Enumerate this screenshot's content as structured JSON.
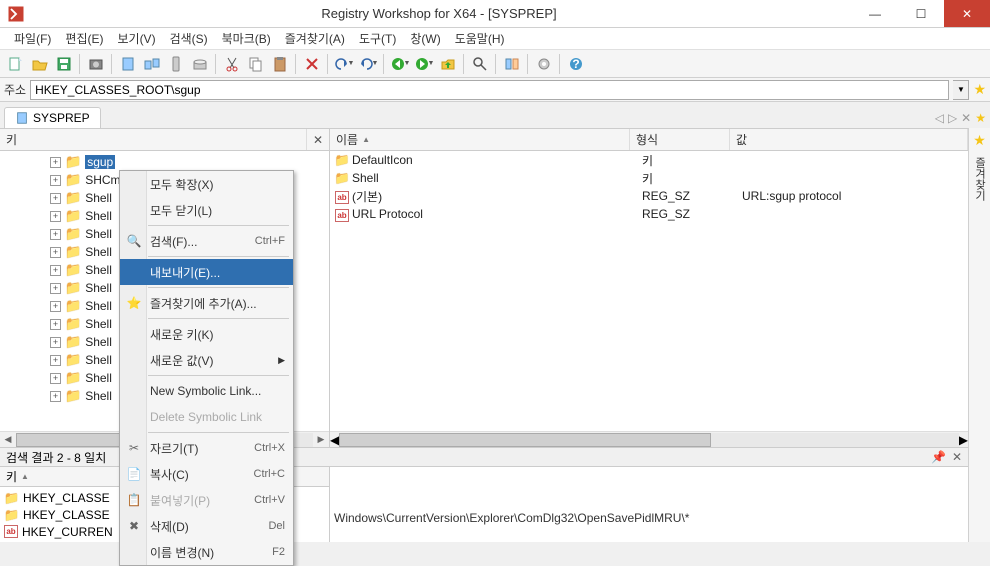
{
  "title": "Registry Workshop for X64 - [SYSPREP]",
  "menu": [
    "파일(F)",
    "편집(E)",
    "보기(V)",
    "검색(S)",
    "북마크(B)",
    "즐겨찾기(A)",
    "도구(T)",
    "창(W)",
    "도움말(H)"
  ],
  "address_label": "주소",
  "address_value": "HKEY_CLASSES_ROOT\\sgup",
  "tab_label": "SYSPREP",
  "rightstrip_label": "즐겨찾기",
  "tree_header": "키",
  "tree_items": [
    {
      "label": "sgup",
      "selected": true
    },
    {
      "label": "SHCm"
    },
    {
      "label": "Shell"
    },
    {
      "label": "Shell"
    },
    {
      "label": "Shell"
    },
    {
      "label": "Shell"
    },
    {
      "label": "Shell"
    },
    {
      "label": "Shell"
    },
    {
      "label": "Shell"
    },
    {
      "label": "Shell"
    },
    {
      "label": "Shell"
    },
    {
      "label": "Shell"
    },
    {
      "label": "Shell"
    },
    {
      "label": "Shell"
    }
  ],
  "list_headers": {
    "name": "이름",
    "type": "형식",
    "value": "값"
  },
  "list_rows": [
    {
      "icon": "folder",
      "name": "DefaultIcon",
      "type": "키",
      "value": ""
    },
    {
      "icon": "folder",
      "name": "Shell",
      "type": "키",
      "value": ""
    },
    {
      "icon": "ab",
      "name": "(기본)",
      "type": "REG_SZ",
      "value": "URL:sgup protocol"
    },
    {
      "icon": "ab",
      "name": "URL Protocol",
      "type": "REG_SZ",
      "value": ""
    }
  ],
  "context_menu": [
    {
      "label": "모두 확장(X)"
    },
    {
      "label": "모두 닫기(L)"
    },
    {
      "sep": true
    },
    {
      "label": "검색(F)...",
      "shortcut": "Ctrl+F",
      "icon": "search"
    },
    {
      "sep": true
    },
    {
      "label": "내보내기(E)...",
      "selected": true
    },
    {
      "sep": true
    },
    {
      "label": "즐겨찾기에 추가(A)...",
      "icon": "star"
    },
    {
      "sep": true
    },
    {
      "label": "새로운 키(K)"
    },
    {
      "label": "새로운 값(V)",
      "submenu": true
    },
    {
      "sep": true
    },
    {
      "label": "New Symbolic Link..."
    },
    {
      "label": "Delete Symbolic Link",
      "disabled": true
    },
    {
      "sep": true
    },
    {
      "label": "자르기(T)",
      "shortcut": "Ctrl+X",
      "icon": "cut"
    },
    {
      "label": "복사(C)",
      "shortcut": "Ctrl+C",
      "icon": "copy"
    },
    {
      "label": "붙여넣기(P)",
      "shortcut": "Ctrl+V",
      "icon": "paste",
      "disabled": true
    },
    {
      "label": "삭제(D)",
      "shortcut": "Del",
      "icon": "delete"
    },
    {
      "label": "이름 변경(N)",
      "shortcut": "F2"
    }
  ],
  "results_header": "검색 결과 2 - 8 일치",
  "results_col": "키",
  "results_rows": [
    {
      "icon": "folder",
      "label": "HKEY_CLASSE"
    },
    {
      "icon": "folder",
      "label": "HKEY_CLASSE"
    },
    {
      "icon": "ab",
      "label": "HKEY_CURREN"
    }
  ],
  "status_text": "Windows\\CurrentVersion\\Explorer\\ComDlg32\\OpenSavePidlMRU\\*"
}
